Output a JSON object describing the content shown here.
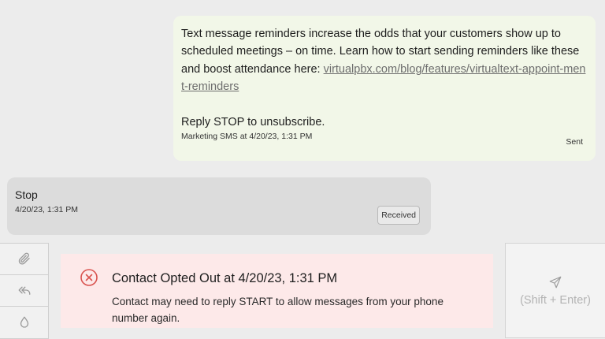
{
  "sent_message": {
    "text_before_link": "Text message reminders increase the odds that your customers show up to scheduled meetings – on time. Learn how to start sending reminders like these and boost attendance here: ",
    "link_text": "virtualpbx.com/blog/features/virtualtext-appoint-ment-reminders",
    "text_after_link": "Reply STOP to unsubscribe.",
    "meta": "Marketing SMS at 4/20/23, 1:31 PM",
    "status": "Sent"
  },
  "received_message": {
    "text": "Stop",
    "timestamp": "4/20/23, 1:31 PM",
    "status": "Received"
  },
  "composer": {
    "tools": [
      "paperclip-icon",
      "reply-all-icon",
      "droplet-icon"
    ],
    "opt_out_banner": {
      "title": "Contact Opted Out at 4/20/23, 1:31 PM",
      "body": "Contact may need to reply START to allow messages from your phone number again."
    },
    "send_hint": "(Shift + Enter)"
  },
  "colors": {
    "sent_bubble": "#f2f7e8",
    "received_bubble": "#dcdcdc",
    "opt_out_bg": "#fde9e9",
    "opt_out_icon": "#d9534f"
  }
}
